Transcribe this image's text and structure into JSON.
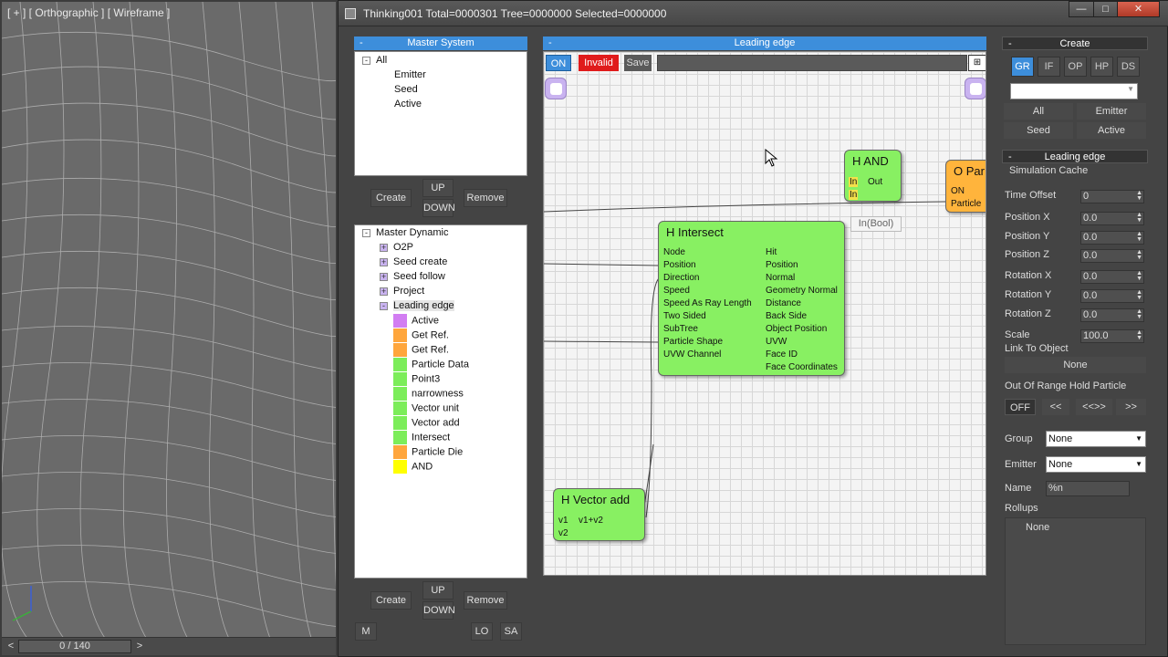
{
  "viewport": {
    "label": "[ + ] [ Orthographic ] [ Wireframe ]",
    "timeline": {
      "value": "0 / 140",
      "prev": "<",
      "next": ">"
    }
  },
  "window": {
    "title": "Thinking001  Total=0000301  Tree=0000000  Selected=0000000",
    "min": "—",
    "max": "□",
    "close": "✕"
  },
  "master_system": {
    "title": "Master System",
    "items": [
      "All",
      "Emitter",
      "Seed",
      "Active"
    ],
    "buttons": {
      "create": "Create",
      "up": "UP",
      "down": "DOWN",
      "remove": "Remove"
    }
  },
  "master_dynamic": {
    "root": "Master Dynamic",
    "groups": [
      "O2P",
      "Seed create",
      "Seed follow",
      "Project",
      "Leading edge"
    ],
    "children": [
      {
        "label": "Active",
        "color": "#d27df2"
      },
      {
        "label": "Get Ref.",
        "color": "#ffa63c"
      },
      {
        "label": "Get Ref.",
        "color": "#ffa63c"
      },
      {
        "label": "Particle Data",
        "color": "#7ced5a"
      },
      {
        "label": "Point3",
        "color": "#7ced5a"
      },
      {
        "label": "narrowness",
        "color": "#7ced5a"
      },
      {
        "label": "Vector unit",
        "color": "#7ced5a"
      },
      {
        "label": "Vector add",
        "color": "#7ced5a"
      },
      {
        "label": "Intersect",
        "color": "#7ced5a"
      },
      {
        "label": "Particle Die",
        "color": "#ffa63c"
      },
      {
        "label": "AND",
        "color": "#ffff00"
      }
    ],
    "buttons": {
      "create": "Create",
      "up": "UP",
      "down": "DOWN",
      "remove": "Remove",
      "m": "M",
      "lo": "LO",
      "sa": "SA"
    }
  },
  "graph": {
    "title": "Leading edge",
    "toolbar": {
      "on": "ON",
      "invalid": "Invalid",
      "save": "Save"
    },
    "nodes": {
      "and": {
        "title": "H AND",
        "inputs": [
          "In",
          "In"
        ],
        "output": "Out"
      },
      "orange": {
        "title": "O Par",
        "ports": [
          "ON",
          "Particle"
        ]
      },
      "intersect": {
        "title": "H Intersect",
        "inputs": [
          "Node",
          "Position",
          "Direction",
          "Speed",
          "Speed As Ray Length",
          "Two Sided",
          "SubTree",
          "Particle Shape",
          "UVW Channel"
        ],
        "outputs": [
          "Hit",
          "Position",
          "Normal",
          "Geometry Normal",
          "Distance",
          "Back Side",
          "Object Position",
          "UVW",
          "Face ID",
          "Face Coordinates"
        ]
      },
      "vector_add": {
        "title": "H Vector add",
        "inputs": [
          "v1",
          "v2"
        ],
        "output": "v1+v2"
      }
    },
    "popup": "In(Bool)"
  },
  "right_panel": {
    "create_title": "Create",
    "tabs": [
      "GR",
      "IF",
      "OP",
      "HP",
      "DS"
    ],
    "filter_buttons": [
      "All",
      "Emitter",
      "Seed",
      "Active"
    ],
    "section_title": "Leading edge",
    "simulation_cache": "Simulation Cache",
    "fields": [
      {
        "label": "Time Offset",
        "value": "0"
      },
      {
        "label": "Position X",
        "value": "0.0"
      },
      {
        "label": "Position Y",
        "value": "0.0"
      },
      {
        "label": "Position Z",
        "value": "0.0"
      },
      {
        "label": "Rotation X",
        "value": "0.0"
      },
      {
        "label": "Rotation Y",
        "value": "0.0"
      },
      {
        "label": "Rotation Z",
        "value": "0.0"
      },
      {
        "label": "Scale",
        "value": "100.0"
      }
    ],
    "link_to_object": "Link To Object",
    "link_value": "None",
    "out_of_range": "Out Of Range Hold Particle",
    "range_buttons": [
      "OFF",
      "<<",
      "<<>>",
      ">>"
    ],
    "group_label": "Group",
    "group_value": "None",
    "emitter_label": "Emitter",
    "emitter_value": "None",
    "name_label": "Name",
    "name_value": "%n",
    "rollups_label": "Rollups",
    "rollups_value": "None"
  }
}
